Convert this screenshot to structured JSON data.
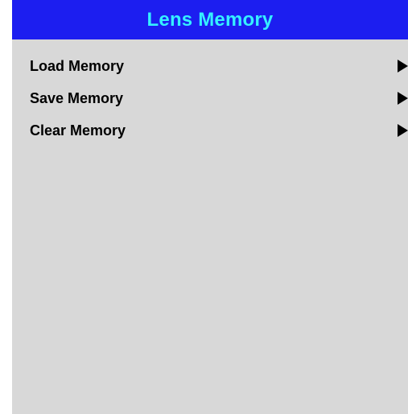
{
  "header": {
    "title": "Lens Memory"
  },
  "menu": {
    "items": [
      {
        "label": "Load Memory",
        "icon": "right-triangle-arrow"
      },
      {
        "label": "Save Memory",
        "icon": "right-triangle-arrow"
      },
      {
        "label": "Clear Memory",
        "icon": "right-triangle-arrow"
      }
    ]
  },
  "colors": {
    "title_bar_bg": "#1c1ef0",
    "title_text": "#35f0ff",
    "panel_bg": "#d8d8d8",
    "item_text": "#000000"
  }
}
